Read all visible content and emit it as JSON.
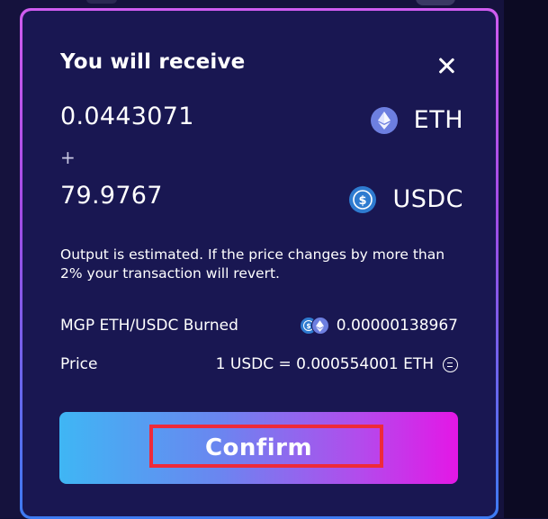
{
  "modal": {
    "title": "You will receive",
    "close_icon": "close-icon"
  },
  "receive": [
    {
      "amount": "0.0443071",
      "token": "ETH",
      "icon": "eth-icon"
    },
    {
      "amount": "79.9767",
      "token": "USDC",
      "icon": "usdc-icon"
    }
  ],
  "separator": "+",
  "notice": "Output is estimated. If the price changes by more than 2% your transaction will revert.",
  "burned": {
    "label": "MGP ETH/USDC Burned",
    "value": "0.00000138967",
    "icon": "usdc-eth-pair-icon"
  },
  "price": {
    "label": "Price",
    "value": "1 USDC = 0.000554001 ETH",
    "icon": "swap-rate-icon"
  },
  "confirm": {
    "label": "Confirm"
  },
  "colors": {
    "modal_background": "#191752",
    "button_gradient_start": "#3fb6f4",
    "button_gradient_end": "#e417e6",
    "highlight_box": "#ee2a3a"
  }
}
